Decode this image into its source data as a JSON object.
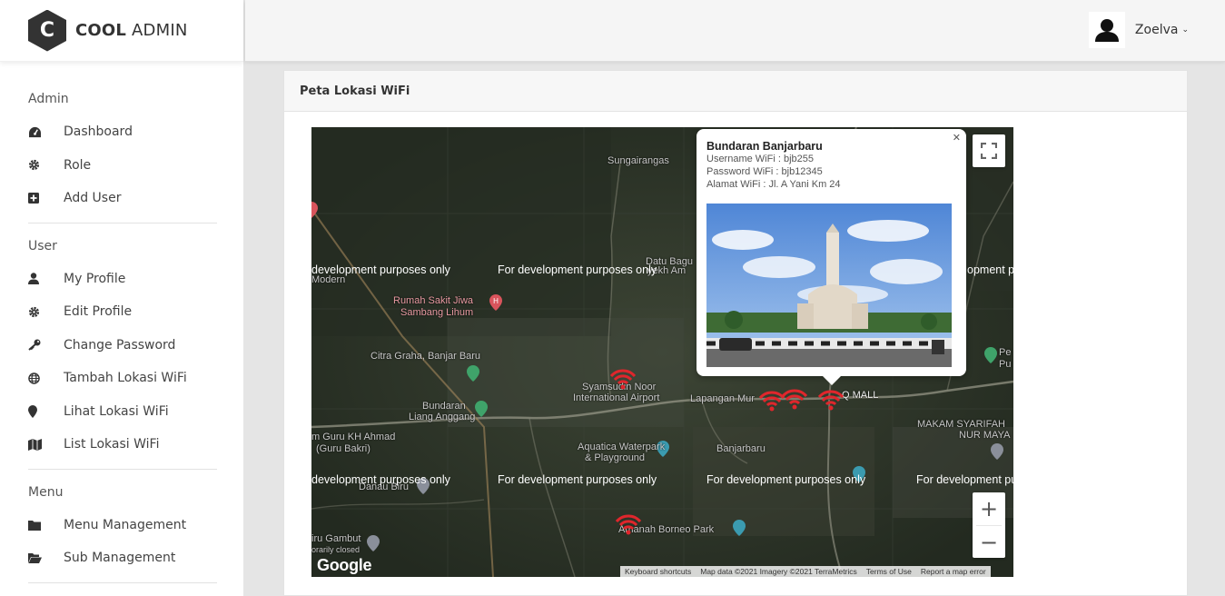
{
  "brand": {
    "logo_letter": "C",
    "name_bold": "COOL",
    "name_light": "ADMIN"
  },
  "header": {
    "user_name": "Zoelva"
  },
  "sidebar": {
    "sections": [
      {
        "title": "Admin",
        "items": [
          {
            "label": "Dashboard",
            "icon": "dashboard-icon"
          },
          {
            "label": "Role",
            "icon": "gear-icon"
          },
          {
            "label": "Add User",
            "icon": "plus-square-icon"
          }
        ]
      },
      {
        "title": "User",
        "items": [
          {
            "label": "My Profile",
            "icon": "user-icon"
          },
          {
            "label": "Edit Profile",
            "icon": "gear-icon"
          },
          {
            "label": "Change Password",
            "icon": "key-icon"
          },
          {
            "label": "Tambah Lokasi WiFi",
            "icon": "globe-icon"
          },
          {
            "label": "Lihat Lokasi WiFi",
            "icon": "map-marker-icon"
          },
          {
            "label": "List Lokasi WiFi",
            "icon": "map-icon"
          }
        ]
      },
      {
        "title": "Menu",
        "items": [
          {
            "label": "Menu Management",
            "icon": "folder-icon"
          },
          {
            "label": "Sub Management",
            "icon": "folder-open-icon"
          }
        ]
      }
    ]
  },
  "card": {
    "title": "Peta Lokasi WiFi"
  },
  "map": {
    "dev_watermark": "For development purposes only",
    "dev_watermark_clipped_left": "development purposes only",
    "dev_watermark_clipped_right_1": "opment pu",
    "dev_watermark_clipped_right_2": "For development pu",
    "labels": {
      "sungairangas": "Sungairangas",
      "datu_bagu": "Datu Bagu",
      "syekh_am": "yekh Am",
      "modern": "Modern",
      "rumah_sakit_1": "Rumah Sakit Jiwa",
      "rumah_sakit_2": "Sambang Lihum",
      "citra_graha": "Citra Graha, Banjar Baru",
      "syamsudin_1": "Syamsudin Noor",
      "syamsudin_2": "International Airport",
      "lapangan": "Lapangan Mur",
      "q_mall": "Q MALL",
      "bundaran_1": "Bundaran",
      "bundaran_2": "Liang Anggang",
      "guru_1": "m Guru KH Ahmad",
      "guru_2": "(Guru Bakri)",
      "aquatica_1": "Aquatica Waterpark",
      "aquatica_2": "& Playground",
      "banjarbaru": "Banjarbaru",
      "makam_1": "MAKAM SYARIFAH",
      "makam_2": "NUR MAYA",
      "danau": "Danau Biru",
      "gambut_1": "iru Gambut",
      "gambut_2": "orarily closed",
      "amanah": "Amanah Borneo Park",
      "pe": "Pe",
      "pu": "Pu"
    },
    "google": "Google",
    "attribution": [
      "Keyboard shortcuts",
      "Map data ©2021 Imagery ©2021 TerraMetrics",
      "Terms of Use",
      "Report a map error"
    ],
    "zoom_in": "+",
    "zoom_out": "−"
  },
  "info_window": {
    "close": "✕",
    "title": "Bundaran Banjarbaru",
    "username": "Username WiFi : bjb255",
    "password": "Password WiFi : bjb12345",
    "address": "Alamat WiFi : Jl. A Yani Km 24"
  },
  "colors": {
    "wifi_marker": "#e0262c",
    "sidebar_bg": "#ffffff",
    "header_bg": "#f5f5f5"
  }
}
